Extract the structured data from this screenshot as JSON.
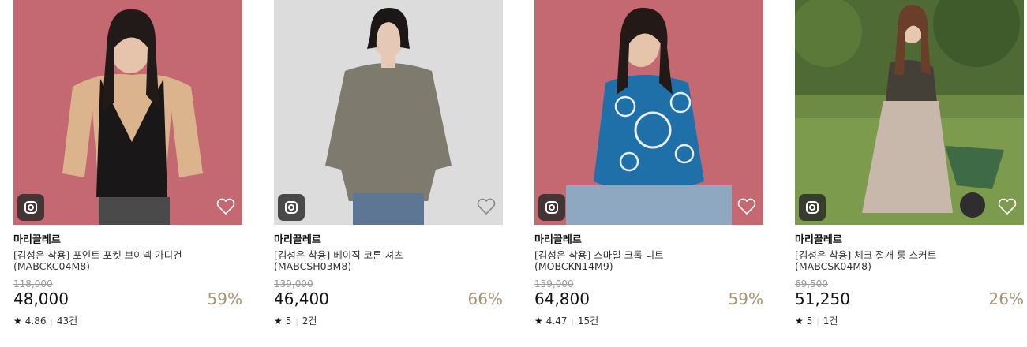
{
  "products": [
    {
      "brand": "마리끌레르",
      "name": "[김성은 착용] 포인트 포켓 브이넥 가디건",
      "code": "(MABCKC04M8)",
      "original_price": "118,000",
      "price": "48,000",
      "discount": "59%",
      "rating": "4.86",
      "reviews": "43건",
      "photo_bg": "#c46872",
      "icon_insta": "instagram-icon",
      "icon_heart": "heart-outline-icon"
    },
    {
      "brand": "마리끌레르",
      "name": "[김성은 착용] 베이직 코튼 셔츠",
      "code": "(MABCSH03M8)",
      "original_price": "139,000",
      "price": "46,400",
      "discount": "66%",
      "rating": "5",
      "reviews": "2건",
      "photo_bg": "#dcdcdc",
      "icon_insta": "instagram-icon",
      "icon_heart": "heart-outline-icon"
    },
    {
      "brand": "마리끌레르",
      "name": "[김성은 착용] 스마일 크롭 니트",
      "code": "(MOBCKN14M9)",
      "original_price": "159,000",
      "price": "64,800",
      "discount": "59%",
      "rating": "4.47",
      "reviews": "15건",
      "photo_bg": "#c46872",
      "icon_insta": "instagram-icon",
      "icon_heart": "heart-outline-icon"
    },
    {
      "brand": "마리끌레르",
      "name": "[김성은 착용] 체크 절개 롱 스커트",
      "code": "(MABCSK04M8)",
      "original_price": "69,500",
      "price": "51,250",
      "discount": "26%",
      "rating": "5",
      "reviews": "1건",
      "photo_bg": "#6f8a45",
      "icon_insta": "instagram-icon",
      "icon_heart": "heart-outline-icon"
    }
  ],
  "colors": {
    "discount": "#a69574",
    "pink_bg": "#c46872",
    "grey_bg": "#dcdcdc"
  }
}
